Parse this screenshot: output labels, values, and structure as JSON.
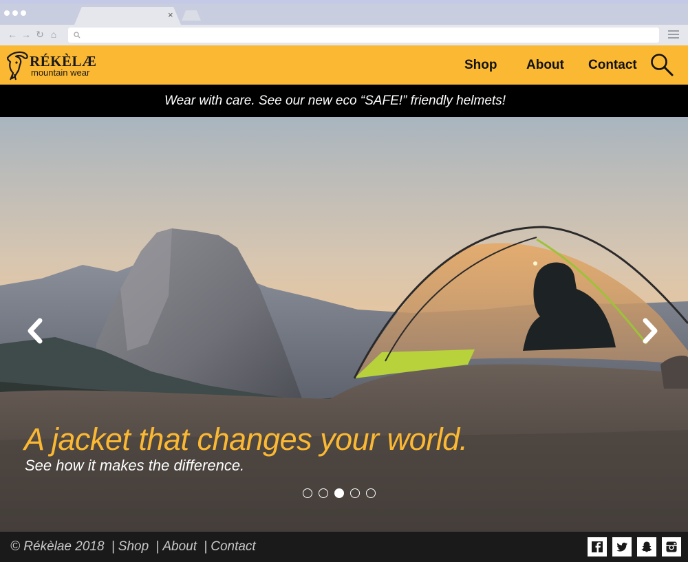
{
  "browser": {
    "tab_close": "×",
    "address_value": "",
    "nav_icons": [
      "back-arrow-icon",
      "forward-arrow-icon",
      "reload-icon",
      "home-icon"
    ],
    "menu_icon": "hamburger-menu-icon"
  },
  "header": {
    "brand": "RÉKÈLÆ",
    "tagline": "mountain wear",
    "nav": {
      "shop": "Shop",
      "about": "About",
      "contact": "Contact"
    },
    "search_icon": "search-icon",
    "background": "#fbb833"
  },
  "banner": {
    "text": "Wear with care. See our new eco “SAFE!” friendly helmets!",
    "background": "#000000"
  },
  "hero": {
    "title": "A jacket that changes your world.",
    "subtitle": "See how it makes the difference.",
    "title_color": "#fbb833",
    "prev_icon": "chevron-left-icon",
    "next_icon": "chevron-right-icon",
    "slide_count": 5,
    "active_slide": 3
  },
  "footer": {
    "copyright": "© Rékèlae 2018",
    "separator": "|",
    "links": {
      "shop": "Shop",
      "about": "About",
      "contact": "Contact"
    },
    "social_icons": [
      "facebook-icon",
      "twitter-icon",
      "snapchat-icon",
      "instagram-icon"
    ]
  }
}
